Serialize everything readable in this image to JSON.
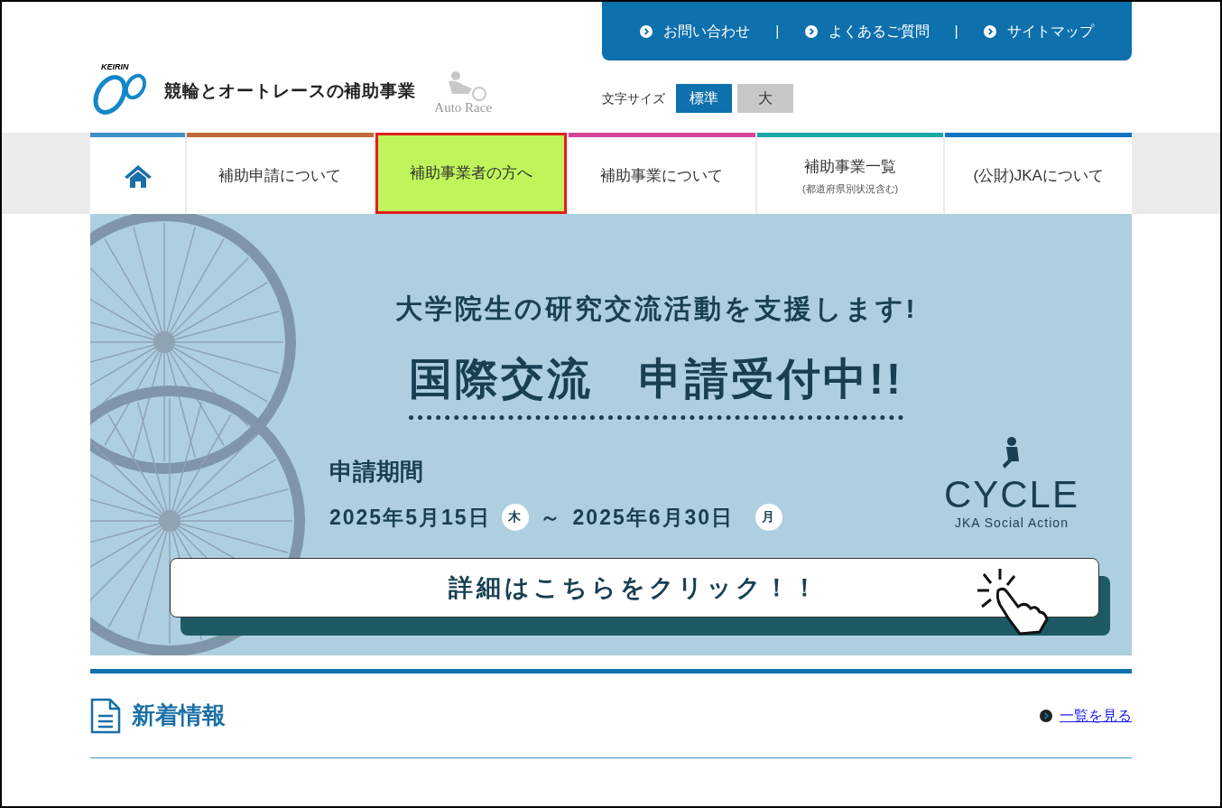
{
  "header": {
    "logo_text": "KEIRIN",
    "site_title": "競輪とオートレースの補助事業",
    "auto_race_label": "Auto Race"
  },
  "top_links": [
    {
      "label": "お問い合わせ"
    },
    {
      "label": "よくあるご質問"
    },
    {
      "label": "サイトマップ"
    }
  ],
  "top_link_separator": "|",
  "font_size": {
    "label": "文字サイズ",
    "options": [
      {
        "label": "標準",
        "selected": true
      },
      {
        "label": "大",
        "selected": false
      }
    ]
  },
  "nav": [
    {
      "kind": "home",
      "color": "#3d8fc6",
      "selected": false
    },
    {
      "kind": "link",
      "label": "補助申請について",
      "color": "#c06a3a",
      "selected": false
    },
    {
      "kind": "link",
      "label": "補助事業者の方へ",
      "selected": true
    },
    {
      "kind": "link",
      "label": "補助事業について",
      "color": "#d6449a",
      "selected": false
    },
    {
      "kind": "link",
      "label": "補助事業一覧",
      "sublabel": "(都道府県別状況含む)",
      "color": "#1aa7a5",
      "selected": false
    },
    {
      "kind": "link",
      "label": "(公財)JKAについて",
      "color": "#1273c1",
      "selected": false
    }
  ],
  "banner": {
    "lead": "大学院生の研究交流活動を支援します!",
    "headline": "国際交流　申請受付中!!",
    "period_label": "申請期間",
    "start_date": "2025年5月15日",
    "start_day": "木",
    "tilde": "～",
    "end_date": "2025年6月30日",
    "end_day": "月",
    "logo_title": "CYCLE",
    "logo_subtitle": "JKA Social Action",
    "button": "詳細はこちらをクリック！！"
  },
  "news": {
    "title": "新着情報",
    "link": "一覧を見る"
  }
}
